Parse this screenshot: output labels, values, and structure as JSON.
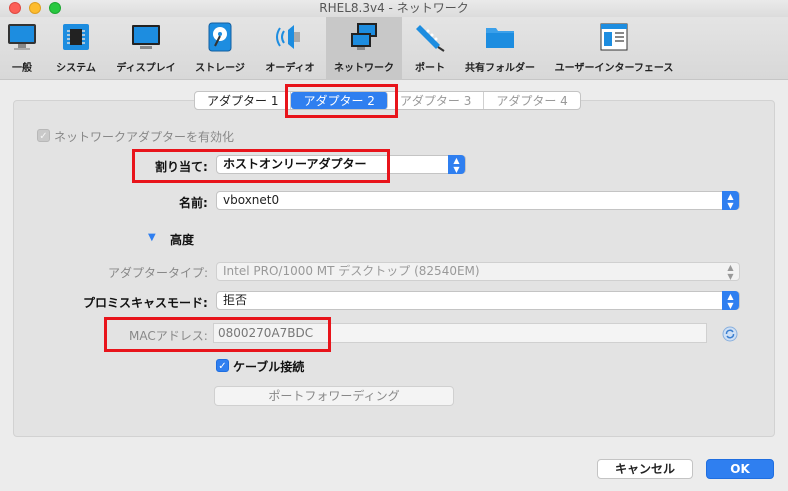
{
  "window": {
    "title": "RHEL8.3v4 - ネットワーク"
  },
  "toolbar": {
    "items": [
      {
        "label": "一般",
        "icon": "monitor-icon"
      },
      {
        "label": "システム",
        "icon": "chip-icon"
      },
      {
        "label": "ディスプレイ",
        "icon": "display-icon"
      },
      {
        "label": "ストレージ",
        "icon": "disk-icon"
      },
      {
        "label": "オーディオ",
        "icon": "speaker-icon"
      },
      {
        "label": "ネットワーク",
        "icon": "network-icon"
      },
      {
        "label": "ポート",
        "icon": "port-icon"
      },
      {
        "label": "共有フォルダー",
        "icon": "folder-icon"
      },
      {
        "label": "ユーザーインターフェース",
        "icon": "ui-icon"
      }
    ]
  },
  "tabs": [
    "アダプター 1",
    "アダプター 2",
    "アダプター 3",
    "アダプター 4"
  ],
  "form": {
    "enable_label": "ネットワークアダプターを有効化",
    "attach_label": "割り当て:",
    "attach_value": "ホストオンリーアダプター",
    "name_label": "名前:",
    "name_value": "vboxnet0",
    "advanced_label": "高度",
    "adapter_type_label": "アダプタータイプ:",
    "adapter_type_value": "Intel PRO/1000 MT デスクトップ (82540EM)",
    "promisc_label": "プロミスキャスモード:",
    "promisc_value": "拒否",
    "mac_label": "MACアドレス:",
    "mac_value": "0800270A7BDC",
    "cable_label": "ケーブル接続",
    "port_forward_label": "ポートフォワーディング"
  },
  "footer": {
    "cancel_label": "キャンセル",
    "ok_label": "OK"
  },
  "colors": {
    "accent": "#2f7ff0",
    "highlight": "#e8141b"
  }
}
